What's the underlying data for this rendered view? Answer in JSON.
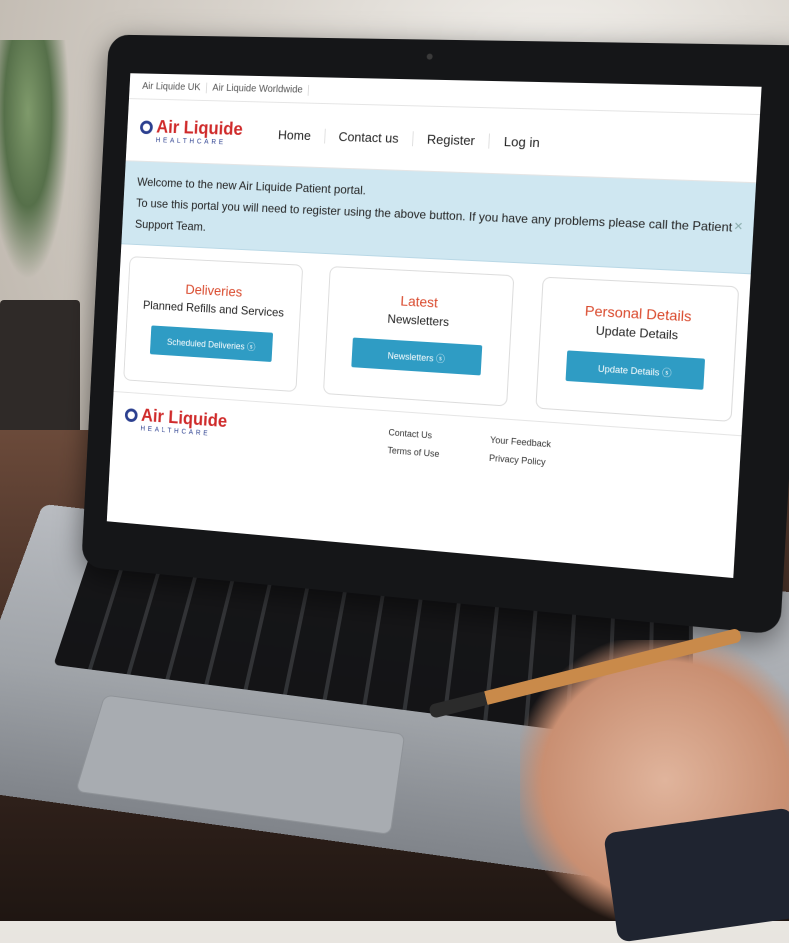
{
  "topbar": {
    "links": [
      "Air Liquide UK",
      "Air Liquide Worldwide"
    ]
  },
  "brand": {
    "name": "Air Liquide",
    "tagline": "HEALTHCARE"
  },
  "nav": {
    "items": [
      "Home",
      "Contact us",
      "Register",
      "Log in"
    ]
  },
  "alert": {
    "line1": "Welcome to the new Air Liquide Patient portal.",
    "line2": "To use this portal you will need to register using the above button.  If you have any problems please call the Patient Support Team.",
    "close": "×"
  },
  "cards": [
    {
      "title": "Deliveries",
      "subtitle": "Planned Refills and Services",
      "button": "Scheduled Deliveries ⓢ"
    },
    {
      "title": "Latest",
      "subtitle": "Newsletters",
      "button": "Newsletters ⓢ"
    },
    {
      "title": "Personal Details",
      "subtitle": "Update Details",
      "button": "Update Details ⓢ"
    }
  ],
  "footer": {
    "col1": [
      "Contact Us",
      "Terms of Use"
    ],
    "col2": [
      "Your Feedback",
      "Privacy Policy"
    ]
  },
  "colors": {
    "accent_red": "#d9482b",
    "button_blue": "#2f9cc4",
    "alert_bg": "#cfe7f1",
    "brand_blue": "#2b3f8f"
  }
}
